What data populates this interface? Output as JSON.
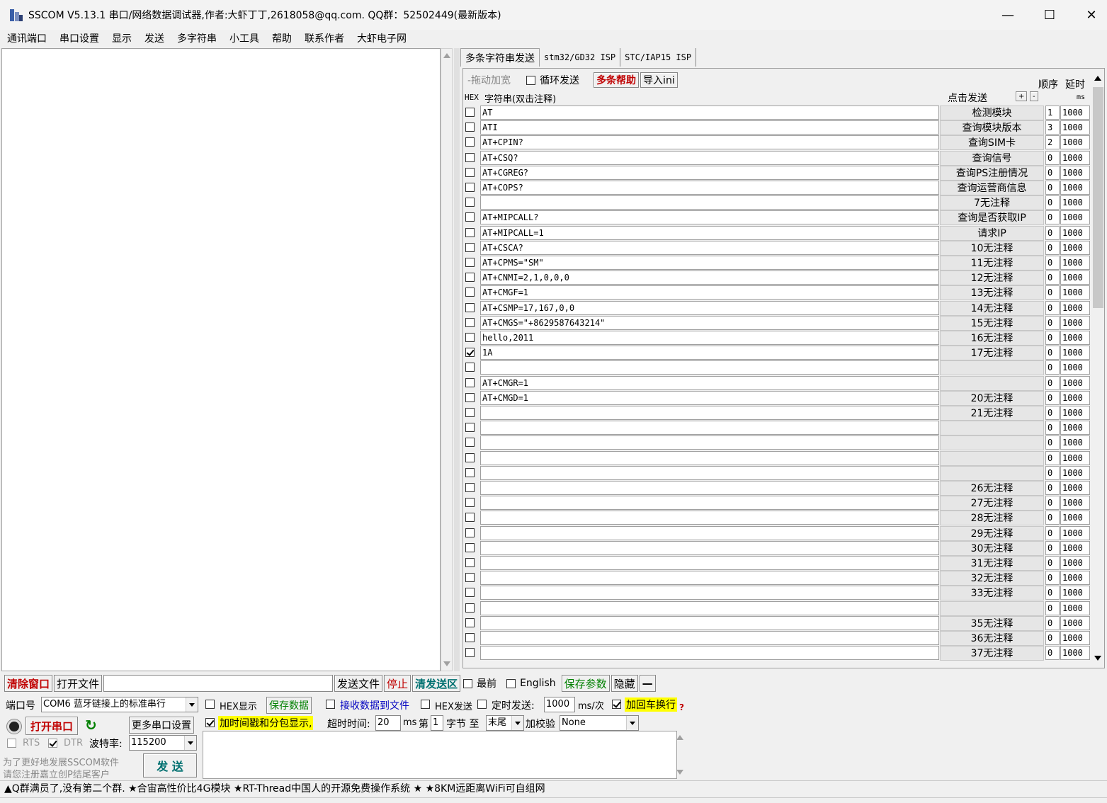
{
  "window": {
    "title": "SSCOM V5.13.1 串口/网络数据调试器,作者:大虾丁丁,2618058@qq.com. QQ群：52502449(最新版本)",
    "min": "—",
    "max": "☐",
    "close": "✕"
  },
  "menu": [
    "通讯端口",
    "串口设置",
    "显示",
    "发送",
    "多字符串",
    "小工具",
    "帮助",
    "联系作者",
    "大虾电子网"
  ],
  "tabs": [
    "多条字符串发送",
    "stm32/GD32 ISP",
    "STC/IAP15 ISP"
  ],
  "multi": {
    "drag_widen": "-拖动加宽",
    "loop_send": "循环发送",
    "help": "多条帮助",
    "import": "导入ini",
    "order": "顺序",
    "delay": "延时",
    "hex_col": "HEX",
    "string_col": "字符串(双击注释)",
    "click_send": "点击发送",
    "plus": "+",
    "minus": "-",
    "ms": "ms"
  },
  "rows": [
    {
      "checked": false,
      "str": "AT",
      "btn": "检测模块",
      "ord": "1",
      "delay": "1000"
    },
    {
      "checked": false,
      "str": "ATI",
      "btn": "查询模块版本",
      "ord": "3",
      "delay": "1000"
    },
    {
      "checked": false,
      "str": "AT+CPIN?",
      "btn": "查询SIM卡",
      "ord": "2",
      "delay": "1000"
    },
    {
      "checked": false,
      "str": "AT+CSQ?",
      "btn": "查询信号",
      "ord": "0",
      "delay": "1000"
    },
    {
      "checked": false,
      "str": "AT+CGREG?",
      "btn": "查询PS注册情况",
      "ord": "0",
      "delay": "1000"
    },
    {
      "checked": false,
      "str": "AT+COPS?",
      "btn": "查询运营商信息",
      "ord": "0",
      "delay": "1000"
    },
    {
      "checked": false,
      "str": "",
      "btn": "7无注释",
      "ord": "0",
      "delay": "1000"
    },
    {
      "checked": false,
      "str": "AT+MIPCALL?",
      "btn": "查询是否获取IP",
      "ord": "0",
      "delay": "1000"
    },
    {
      "checked": false,
      "str": "AT+MIPCALL=1",
      "btn": "请求IP",
      "ord": "0",
      "delay": "1000"
    },
    {
      "checked": false,
      "str": "AT+CSCA?",
      "btn": "10无注释",
      "ord": "0",
      "delay": "1000"
    },
    {
      "checked": false,
      "str": "AT+CPMS=\"SM\"",
      "btn": "11无注释",
      "ord": "0",
      "delay": "1000"
    },
    {
      "checked": false,
      "str": "AT+CNMI=2,1,0,0,0",
      "btn": "12无注释",
      "ord": "0",
      "delay": "1000"
    },
    {
      "checked": false,
      "str": "AT+CMGF=1",
      "btn": "13无注释",
      "ord": "0",
      "delay": "1000"
    },
    {
      "checked": false,
      "str": "AT+CSMP=17,167,0,0",
      "btn": "14无注释",
      "ord": "0",
      "delay": "1000"
    },
    {
      "checked": false,
      "str": "AT+CMGS=\"+8629587643214\"",
      "btn": "15无注释",
      "ord": "0",
      "delay": "1000"
    },
    {
      "checked": false,
      "str": "hello,2011",
      "btn": "16无注释",
      "ord": "0",
      "delay": "1000"
    },
    {
      "checked": true,
      "str": "1A",
      "btn": "17无注释",
      "ord": "0",
      "delay": "1000"
    },
    {
      "checked": false,
      "str": "",
      "btn": "",
      "ord": "0",
      "delay": "1000"
    },
    {
      "checked": false,
      "str": "AT+CMGR=1",
      "btn": "",
      "ord": "0",
      "delay": "1000"
    },
    {
      "checked": false,
      "str": "AT+CMGD=1",
      "btn": "20无注释",
      "ord": "0",
      "delay": "1000"
    },
    {
      "checked": false,
      "str": "",
      "btn": "21无注释",
      "ord": "0",
      "delay": "1000"
    },
    {
      "checked": false,
      "str": "",
      "btn": "",
      "ord": "0",
      "delay": "1000"
    },
    {
      "checked": false,
      "str": "",
      "btn": "",
      "ord": "0",
      "delay": "1000"
    },
    {
      "checked": false,
      "str": "",
      "btn": "",
      "ord": "0",
      "delay": "1000"
    },
    {
      "checked": false,
      "str": "",
      "btn": "",
      "ord": "0",
      "delay": "1000"
    },
    {
      "checked": false,
      "str": "",
      "btn": "26无注释",
      "ord": "0",
      "delay": "1000"
    },
    {
      "checked": false,
      "str": "",
      "btn": "27无注释",
      "ord": "0",
      "delay": "1000"
    },
    {
      "checked": false,
      "str": "",
      "btn": "28无注释",
      "ord": "0",
      "delay": "1000"
    },
    {
      "checked": false,
      "str": "",
      "btn": "29无注释",
      "ord": "0",
      "delay": "1000"
    },
    {
      "checked": false,
      "str": "",
      "btn": "30无注释",
      "ord": "0",
      "delay": "1000"
    },
    {
      "checked": false,
      "str": "",
      "btn": "31无注释",
      "ord": "0",
      "delay": "1000"
    },
    {
      "checked": false,
      "str": "",
      "btn": "32无注释",
      "ord": "0",
      "delay": "1000"
    },
    {
      "checked": false,
      "str": "",
      "btn": "33无注释",
      "ord": "0",
      "delay": "1000"
    },
    {
      "checked": false,
      "str": "",
      "btn": "",
      "ord": "0",
      "delay": "1000"
    },
    {
      "checked": false,
      "str": "",
      "btn": "35无注释",
      "ord": "0",
      "delay": "1000"
    },
    {
      "checked": false,
      "str": "",
      "btn": "36无注释",
      "ord": "0",
      "delay": "1000"
    },
    {
      "checked": false,
      "str": "",
      "btn": "37无注释",
      "ord": "0",
      "delay": "1000"
    }
  ],
  "bottom": {
    "clear_window": "清除窗口",
    "open_file": "打开文件",
    "send_file": "发送文件",
    "stop": "停止",
    "clear_send": "清发送区",
    "topmost": "最前",
    "english": "English",
    "save_params": "保存参数",
    "hide": "隐藏",
    "dash": "—",
    "port_label": "端口号",
    "port_value": "COM6 蓝牙链接上的标准串行",
    "open_port": "打开串口",
    "more_settings": "更多串口设置",
    "rts": "RTS",
    "dtr": "DTR",
    "baud_label": "波特率:",
    "baud_value": "115200",
    "promo1": "为了更好地发展SSCOM软件",
    "promo2": "请您注册嘉立创P结尾客户",
    "send": "发 送",
    "hex_display": "HEX显示",
    "save_data": "保存数据",
    "recv_to_file": "接收数据到文件",
    "hex_send": "HEX发送",
    "timed_send": "定时发送:",
    "timed_value": "1000",
    "ms_per": "ms/次",
    "add_crlf": "加回车换行",
    "question": "?",
    "timestamp": "加时间戳和分包显示,",
    "timeout_label": "超时时间:",
    "timeout_value": "20",
    "ms": "ms",
    "nth": "第",
    "nth_value": "1",
    "byte_to": "字节 至",
    "tail": "末尾",
    "checksum": "加校验",
    "checksum_value": "None"
  },
  "status": "▲Q群满员了,没有第二个群. ★合宙高性价比4G模块 ★RT-Thread中国人的开源免费操作系统 ★ ★8KM远距离WiFi可自组网",
  "colors": {
    "accent_red": "#c00000",
    "accent_green": "#008000",
    "teal": "#007070",
    "highlight_yellow": "#ffff00",
    "blue_link": "#0000c0"
  }
}
